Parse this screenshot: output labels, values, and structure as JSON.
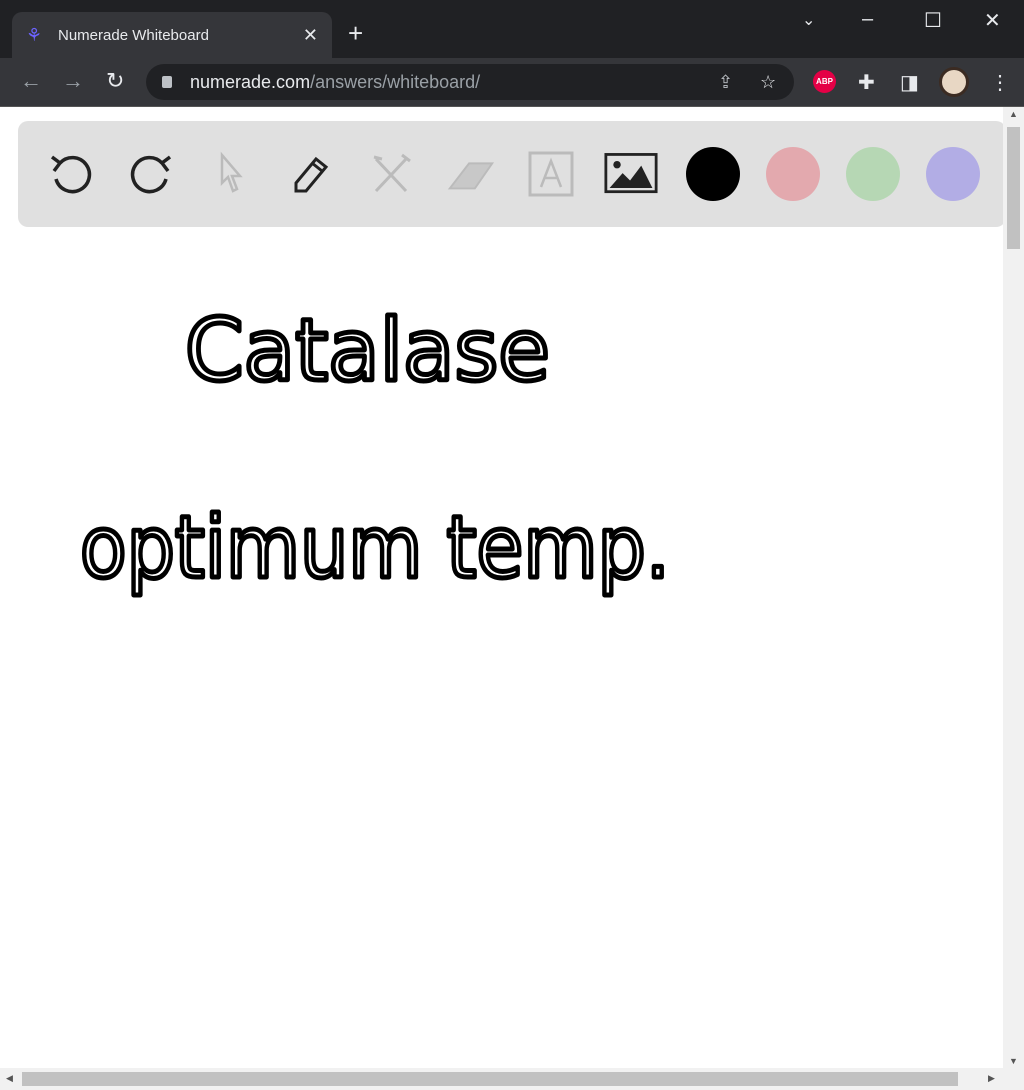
{
  "browser": {
    "tab_title": "Numerade Whiteboard",
    "url_host": "numerade.com",
    "url_path": "/answers/whiteboard/",
    "extension_abp": "ABP"
  },
  "toolbar": {
    "tools": [
      "undo-icon",
      "redo-icon",
      "select-icon",
      "pen-icon",
      "tools-icon",
      "eraser-icon",
      "text-icon",
      "image-icon"
    ],
    "colors": {
      "black": "#000000",
      "pink": "#e3a9ae",
      "green": "#b6d7b4",
      "purple": "#b2ade5"
    }
  },
  "canvas": {
    "line1": "Catalase",
    "line2": "optimum temp."
  }
}
